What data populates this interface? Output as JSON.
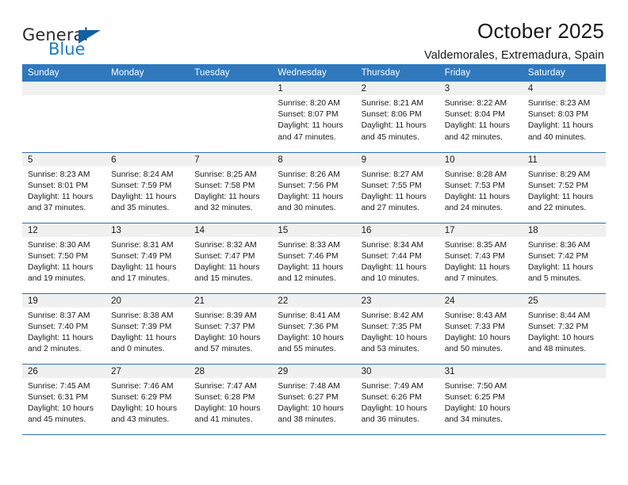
{
  "logo": {
    "word_one": "General",
    "word_two": "Blue",
    "triangle_color": "#1060a8",
    "blue_text_color": "#1f7dc4"
  },
  "header": {
    "title": "October 2025",
    "subtitle": "Valdemorales, Extremadura, Spain"
  },
  "theme": {
    "header_blue": "#3079bd",
    "rule_blue": "#2f6fa8",
    "daynum_band": "#f0f0f0"
  },
  "calendar": {
    "weekday_headers": [
      "Sunday",
      "Monday",
      "Tuesday",
      "Wednesday",
      "Thursday",
      "Friday",
      "Saturday"
    ],
    "labels": {
      "sunrise_prefix": "Sunrise:",
      "sunset_prefix": "Sunset:",
      "daylight_prefix": "Daylight:"
    },
    "weeks": [
      [
        {
          "day": "",
          "empty": true
        },
        {
          "day": "",
          "empty": true
        },
        {
          "day": "",
          "empty": true
        },
        {
          "day": "1",
          "sunrise": "Sunrise: 8:20 AM",
          "sunset": "Sunset: 8:07 PM",
          "daylight_line1": "Daylight: 11 hours",
          "daylight_line2": "and 47 minutes."
        },
        {
          "day": "2",
          "sunrise": "Sunrise: 8:21 AM",
          "sunset": "Sunset: 8:06 PM",
          "daylight_line1": "Daylight: 11 hours",
          "daylight_line2": "and 45 minutes."
        },
        {
          "day": "3",
          "sunrise": "Sunrise: 8:22 AM",
          "sunset": "Sunset: 8:04 PM",
          "daylight_line1": "Daylight: 11 hours",
          "daylight_line2": "and 42 minutes."
        },
        {
          "day": "4",
          "sunrise": "Sunrise: 8:23 AM",
          "sunset": "Sunset: 8:03 PM",
          "daylight_line1": "Daylight: 11 hours",
          "daylight_line2": "and 40 minutes."
        }
      ],
      [
        {
          "day": "5",
          "sunrise": "Sunrise: 8:23 AM",
          "sunset": "Sunset: 8:01 PM",
          "daylight_line1": "Daylight: 11 hours",
          "daylight_line2": "and 37 minutes."
        },
        {
          "day": "6",
          "sunrise": "Sunrise: 8:24 AM",
          "sunset": "Sunset: 7:59 PM",
          "daylight_line1": "Daylight: 11 hours",
          "daylight_line2": "and 35 minutes."
        },
        {
          "day": "7",
          "sunrise": "Sunrise: 8:25 AM",
          "sunset": "Sunset: 7:58 PM",
          "daylight_line1": "Daylight: 11 hours",
          "daylight_line2": "and 32 minutes."
        },
        {
          "day": "8",
          "sunrise": "Sunrise: 8:26 AM",
          "sunset": "Sunset: 7:56 PM",
          "daylight_line1": "Daylight: 11 hours",
          "daylight_line2": "and 30 minutes."
        },
        {
          "day": "9",
          "sunrise": "Sunrise: 8:27 AM",
          "sunset": "Sunset: 7:55 PM",
          "daylight_line1": "Daylight: 11 hours",
          "daylight_line2": "and 27 minutes."
        },
        {
          "day": "10",
          "sunrise": "Sunrise: 8:28 AM",
          "sunset": "Sunset: 7:53 PM",
          "daylight_line1": "Daylight: 11 hours",
          "daylight_line2": "and 24 minutes."
        },
        {
          "day": "11",
          "sunrise": "Sunrise: 8:29 AM",
          "sunset": "Sunset: 7:52 PM",
          "daylight_line1": "Daylight: 11 hours",
          "daylight_line2": "and 22 minutes."
        }
      ],
      [
        {
          "day": "12",
          "sunrise": "Sunrise: 8:30 AM",
          "sunset": "Sunset: 7:50 PM",
          "daylight_line1": "Daylight: 11 hours",
          "daylight_line2": "and 19 minutes."
        },
        {
          "day": "13",
          "sunrise": "Sunrise: 8:31 AM",
          "sunset": "Sunset: 7:49 PM",
          "daylight_line1": "Daylight: 11 hours",
          "daylight_line2": "and 17 minutes."
        },
        {
          "day": "14",
          "sunrise": "Sunrise: 8:32 AM",
          "sunset": "Sunset: 7:47 PM",
          "daylight_line1": "Daylight: 11 hours",
          "daylight_line2": "and 15 minutes."
        },
        {
          "day": "15",
          "sunrise": "Sunrise: 8:33 AM",
          "sunset": "Sunset: 7:46 PM",
          "daylight_line1": "Daylight: 11 hours",
          "daylight_line2": "and 12 minutes."
        },
        {
          "day": "16",
          "sunrise": "Sunrise: 8:34 AM",
          "sunset": "Sunset: 7:44 PM",
          "daylight_line1": "Daylight: 11 hours",
          "daylight_line2": "and 10 minutes."
        },
        {
          "day": "17",
          "sunrise": "Sunrise: 8:35 AM",
          "sunset": "Sunset: 7:43 PM",
          "daylight_line1": "Daylight: 11 hours",
          "daylight_line2": "and 7 minutes."
        },
        {
          "day": "18",
          "sunrise": "Sunrise: 8:36 AM",
          "sunset": "Sunset: 7:42 PM",
          "daylight_line1": "Daylight: 11 hours",
          "daylight_line2": "and 5 minutes."
        }
      ],
      [
        {
          "day": "19",
          "sunrise": "Sunrise: 8:37 AM",
          "sunset": "Sunset: 7:40 PM",
          "daylight_line1": "Daylight: 11 hours",
          "daylight_line2": "and 2 minutes."
        },
        {
          "day": "20",
          "sunrise": "Sunrise: 8:38 AM",
          "sunset": "Sunset: 7:39 PM",
          "daylight_line1": "Daylight: 11 hours",
          "daylight_line2": "and 0 minutes."
        },
        {
          "day": "21",
          "sunrise": "Sunrise: 8:39 AM",
          "sunset": "Sunset: 7:37 PM",
          "daylight_line1": "Daylight: 10 hours",
          "daylight_line2": "and 57 minutes."
        },
        {
          "day": "22",
          "sunrise": "Sunrise: 8:41 AM",
          "sunset": "Sunset: 7:36 PM",
          "daylight_line1": "Daylight: 10 hours",
          "daylight_line2": "and 55 minutes."
        },
        {
          "day": "23",
          "sunrise": "Sunrise: 8:42 AM",
          "sunset": "Sunset: 7:35 PM",
          "daylight_line1": "Daylight: 10 hours",
          "daylight_line2": "and 53 minutes."
        },
        {
          "day": "24",
          "sunrise": "Sunrise: 8:43 AM",
          "sunset": "Sunset: 7:33 PM",
          "daylight_line1": "Daylight: 10 hours",
          "daylight_line2": "and 50 minutes."
        },
        {
          "day": "25",
          "sunrise": "Sunrise: 8:44 AM",
          "sunset": "Sunset: 7:32 PM",
          "daylight_line1": "Daylight: 10 hours",
          "daylight_line2": "and 48 minutes."
        }
      ],
      [
        {
          "day": "26",
          "sunrise": "Sunrise: 7:45 AM",
          "sunset": "Sunset: 6:31 PM",
          "daylight_line1": "Daylight: 10 hours",
          "daylight_line2": "and 45 minutes."
        },
        {
          "day": "27",
          "sunrise": "Sunrise: 7:46 AM",
          "sunset": "Sunset: 6:29 PM",
          "daylight_line1": "Daylight: 10 hours",
          "daylight_line2": "and 43 minutes."
        },
        {
          "day": "28",
          "sunrise": "Sunrise: 7:47 AM",
          "sunset": "Sunset: 6:28 PM",
          "daylight_line1": "Daylight: 10 hours",
          "daylight_line2": "and 41 minutes."
        },
        {
          "day": "29",
          "sunrise": "Sunrise: 7:48 AM",
          "sunset": "Sunset: 6:27 PM",
          "daylight_line1": "Daylight: 10 hours",
          "daylight_line2": "and 38 minutes."
        },
        {
          "day": "30",
          "sunrise": "Sunrise: 7:49 AM",
          "sunset": "Sunset: 6:26 PM",
          "daylight_line1": "Daylight: 10 hours",
          "daylight_line2": "and 36 minutes."
        },
        {
          "day": "31",
          "sunrise": "Sunrise: 7:50 AM",
          "sunset": "Sunset: 6:25 PM",
          "daylight_line1": "Daylight: 10 hours",
          "daylight_line2": "and 34 minutes."
        },
        {
          "day": "",
          "empty": true
        }
      ]
    ]
  }
}
